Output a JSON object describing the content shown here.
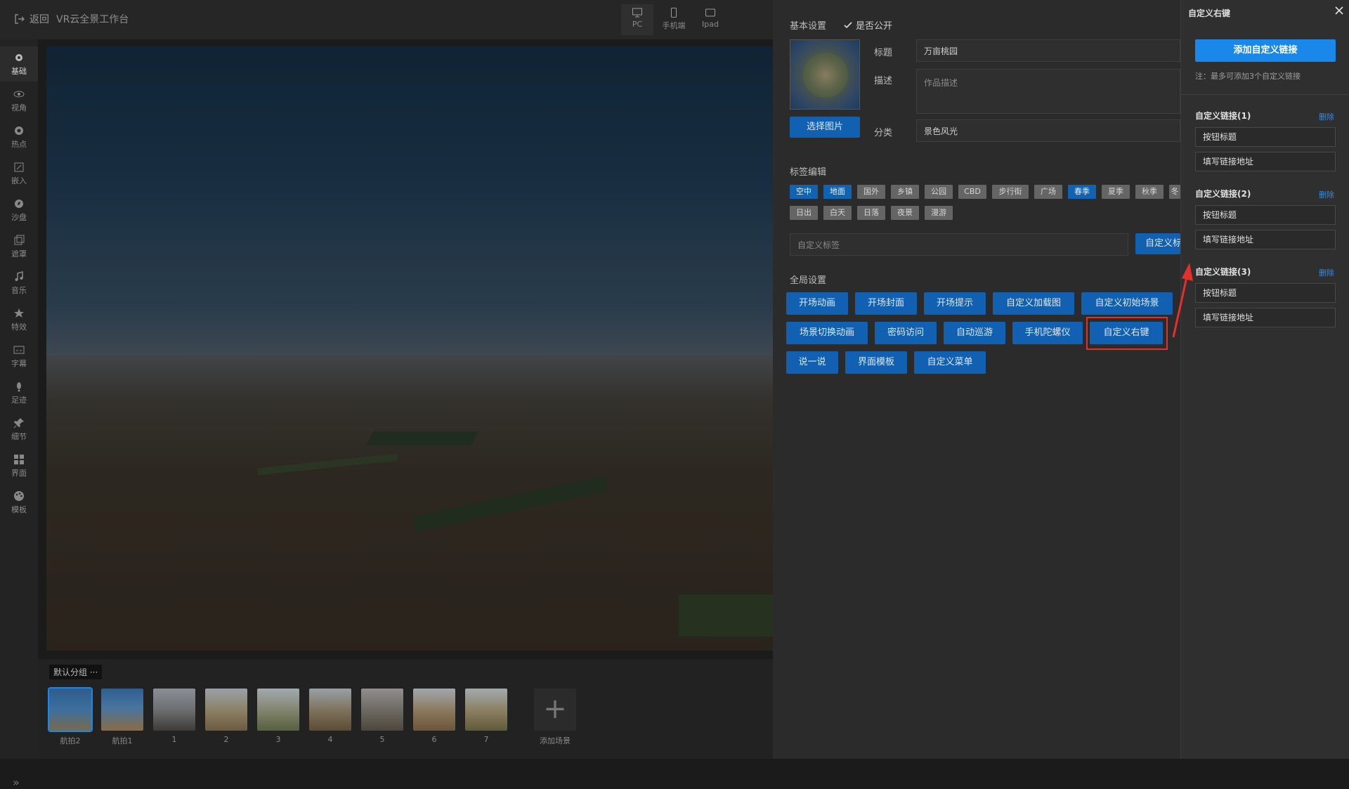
{
  "topbar": {
    "back_label": "返回",
    "app_title": "VR云全景工作台",
    "devices": [
      {
        "label": "PC",
        "icon": "monitor-icon",
        "active": true
      },
      {
        "label": "手机端",
        "icon": "phone-icon",
        "active": false
      },
      {
        "label": "Ipad",
        "icon": "tablet-icon",
        "active": false
      }
    ]
  },
  "sidebar": {
    "items": [
      {
        "label": "基础",
        "icon": "gear-icon"
      },
      {
        "label": "视角",
        "icon": "eye-icon"
      },
      {
        "label": "热点",
        "icon": "hotspot-icon"
      },
      {
        "label": "嵌入",
        "icon": "embed-icon"
      },
      {
        "label": "沙盘",
        "icon": "compass-icon"
      },
      {
        "label": "遮罩",
        "icon": "mask-icon"
      },
      {
        "label": "音乐",
        "icon": "music-icon"
      },
      {
        "label": "特效",
        "icon": "star-icon"
      },
      {
        "label": "字幕",
        "icon": "subtitle-icon"
      },
      {
        "label": "足迹",
        "icon": "footprint-icon"
      },
      {
        "label": "细节",
        "icon": "pin-icon"
      },
      {
        "label": "界面",
        "icon": "layout-icon"
      },
      {
        "label": "模板",
        "icon": "palette-icon"
      }
    ],
    "collapse_icon": "double-chevron-right-icon"
  },
  "scenes": {
    "group_label": "默认分组 ···",
    "items": [
      "航拍2",
      "航拍1",
      "1",
      "2",
      "3",
      "4",
      "5",
      "6",
      "7"
    ],
    "add_label": "添加场景"
  },
  "settings": {
    "basic_title": "基本设置",
    "public_label": "是否公开",
    "public_checked": true,
    "title_label": "标题",
    "title_value": "万亩桃园",
    "desc_label": "描述",
    "desc_placeholder": "作品描述",
    "category_label": "分类",
    "category_value": "景色风光",
    "choose_image": "选择图片",
    "tags_title": "标签编辑",
    "tags": [
      {
        "label": "空中",
        "on": true
      },
      {
        "label": "地面",
        "on": true
      },
      {
        "label": "国外",
        "on": false
      },
      {
        "label": "乡镇",
        "on": false
      },
      {
        "label": "公园",
        "on": false
      },
      {
        "label": "CBD",
        "on": false
      },
      {
        "label": "步行街",
        "on": false
      },
      {
        "label": "广场",
        "on": false
      },
      {
        "label": "春季",
        "on": true
      },
      {
        "label": "夏季",
        "on": false
      },
      {
        "label": "秋季",
        "on": false
      },
      {
        "label": "冬",
        "on": false
      },
      {
        "label": "日出",
        "on": false
      },
      {
        "label": "白天",
        "on": false
      },
      {
        "label": "日落",
        "on": false
      },
      {
        "label": "夜景",
        "on": false
      },
      {
        "label": "漫游",
        "on": false
      }
    ],
    "custom_tag_placeholder": "自定义标签",
    "custom_tag_button": "自定义标",
    "global_title": "全局设置",
    "global_buttons": [
      "开场动画",
      "开场封面",
      "开场提示",
      "自定义加载图",
      "自定义初始场景",
      "场景切换动画",
      "密码访问",
      "自动巡游",
      "手机陀螺仪",
      "自定义右键",
      "说一说",
      "界面模板",
      "自定义菜单"
    ]
  },
  "right_panel": {
    "title": "自定义右键",
    "close_icon": "close-icon",
    "add_button": "添加自定义链接",
    "note": "注：最多可添加3个自定义链接",
    "links": [
      {
        "heading": "自定义链接(1)",
        "delete": "删除",
        "button_title": "按钮标题",
        "url": "填写链接地址"
      },
      {
        "heading": "自定义链接(2)",
        "delete": "删除",
        "button_title": "按钮标题",
        "url": "填写链接地址"
      },
      {
        "heading": "自定义链接(3)",
        "delete": "删除",
        "button_title": "按钮标题",
        "url": "填写链接地址"
      }
    ]
  },
  "colors": {
    "accent": "#1260b1",
    "accent_bright": "#1a88e8",
    "highlight": "#e2302a"
  }
}
